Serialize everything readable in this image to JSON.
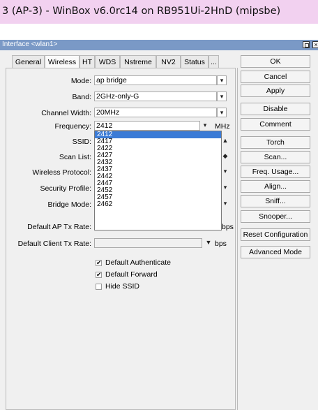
{
  "window_title": "3 (AP-3) - WinBox v6.0rc14 on RB951Ui-2HnD (mipsbe)",
  "dialog": {
    "title": "Interface <wlan1>",
    "tabs": [
      "General",
      "Wireless",
      "HT",
      "WDS",
      "Nstreme",
      "NV2",
      "Status",
      "..."
    ],
    "active_tab": "Wireless"
  },
  "form": {
    "mode_label": "Mode:",
    "mode_value": "ap bridge",
    "band_label": "Band:",
    "band_value": "2GHz-only-G",
    "channel_width_label": "Channel Width:",
    "channel_width_value": "20MHz",
    "frequency_label": "Frequency:",
    "frequency_value": "2412",
    "frequency_unit": "MHz",
    "ssid_label": "SSID:",
    "scan_list_label": "Scan List:",
    "wireless_protocol_label": "Wireless Protocol:",
    "security_profile_label": "Security Profile:",
    "bridge_mode_label": "Bridge Mode:",
    "default_ap_tx_rate_label": "Default AP Tx Rate:",
    "default_ap_tx_rate_unit": "bps",
    "default_client_tx_rate_label": "Default Client Tx Rate:",
    "default_client_tx_rate_unit": "bps",
    "frequency_options": [
      "2412",
      "2417",
      "2422",
      "2427",
      "2432",
      "2437",
      "2442",
      "2447",
      "2452",
      "2457",
      "2462"
    ],
    "selected_option": "2412",
    "checkboxes": [
      {
        "label": "Default Authenticate",
        "checked": true
      },
      {
        "label": "Default Forward",
        "checked": true
      },
      {
        "label": "Hide SSID",
        "checked": false
      }
    ]
  },
  "buttons": {
    "ok": "OK",
    "cancel": "Cancel",
    "apply": "Apply",
    "disable": "Disable",
    "comment": "Comment",
    "torch": "Torch",
    "scan": "Scan...",
    "freq_usage": "Freq. Usage...",
    "align": "Align...",
    "sniff": "Sniff...",
    "snooper": "Snooper...",
    "reset_configuration": "Reset Configuration",
    "advanced_mode": "Advanced Mode"
  },
  "colors": {
    "titlebar": "#f2d1f0",
    "dialog_title": "#7a99c6",
    "selection": "#3b7bd6"
  }
}
